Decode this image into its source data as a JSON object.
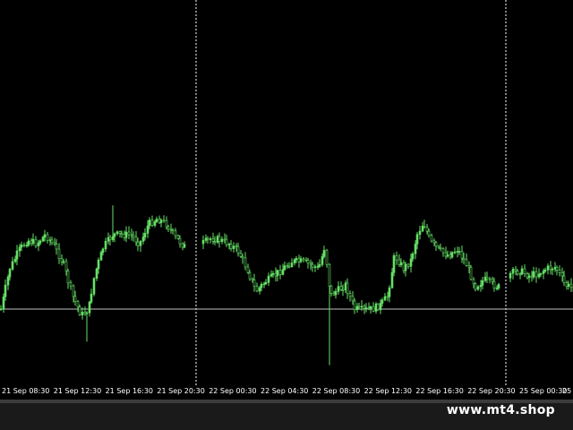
{
  "chart": {
    "type": "candlestick",
    "background_color": "#000000",
    "candle_color": "#66e066",
    "grid_color": "#ffffff",
    "vertical_separators": [
      "22 Sep 00:00",
      "25 Sep 00:00"
    ],
    "axis_ticks": [
      "21 Sep 08:30",
      "21 Sep 12:30",
      "21 Sep 16:30",
      "21 Sep 20:30",
      "22 Sep 00:30",
      "22 Sep 04:30",
      "22 Sep 08:30",
      "22 Sep 12:30",
      "22 Sep 16:30",
      "22 Sep 20:30",
      "25 Sep 00:30",
      "25"
    ]
  },
  "watermark": {
    "text": "www.mt4.shop"
  }
}
